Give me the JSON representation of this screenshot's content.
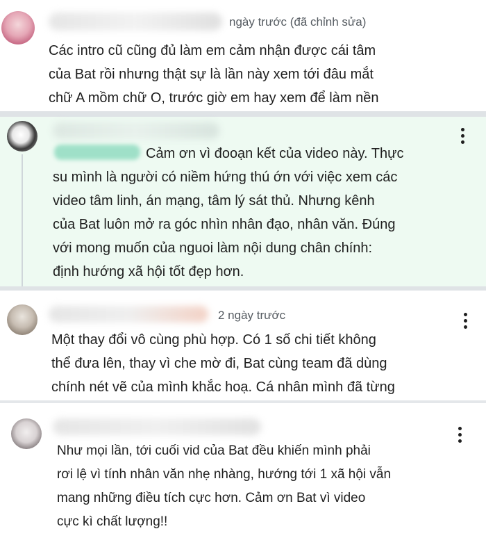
{
  "comments": [
    {
      "time": "ngày trước (đã chỉnh sửa)",
      "lines": [
        "Các intro cũ cũng đủ làm em cảm nhận được cái tâm",
        "của Bat rồi nhưng thật sự là lần này xem tới đâu mắt",
        "chữ A mồm chữ O, trước giờ em hay xem để làm nền"
      ]
    },
    {
      "lines": [
        "Cảm ơn vì đooạn kết của video này. Thực",
        "su mình là người có niềm hứng thú ớn với việc xem các",
        "video tâm linh, án mạng, tâm lý sát thủ. Nhưng kênh",
        "của Bat luôn mở ra góc nhìn nhân đạo, nhân văn. Đúng",
        "với mong muốn của nguoi làm nội dung chân chính:",
        "định hướng xã hội tốt đẹp hơn."
      ]
    },
    {
      "time": "2 ngày trước",
      "lines": [
        "Một thay đổi vô cùng phù hợp. Có 1 số chi tiết không",
        "thể đưa lên, thay vì che mờ đi, Bat cùng team đã dùng",
        "chính nét vẽ của mình khắc hoạ. Cá nhân mình đã từng"
      ]
    },
    {
      "lines": [
        "Như mọi lần, tới cuối vid của Bat đều khiến mình phải",
        "rơi lệ vì tính nhân văn nhẹ nhàng, hướng tới 1 xã hội vẫn",
        "mang những điều tích cực hơn. Cảm ơn Bat vì video",
        "cực kì chất lượng!!"
      ]
    }
  ],
  "icons": {
    "more": "vertical-ellipsis-icon"
  },
  "colors": {
    "highlight_bg": "#eefaf2",
    "separator": "#dfe3e6",
    "text": "#1f1f1f",
    "meta": "#555b61"
  }
}
